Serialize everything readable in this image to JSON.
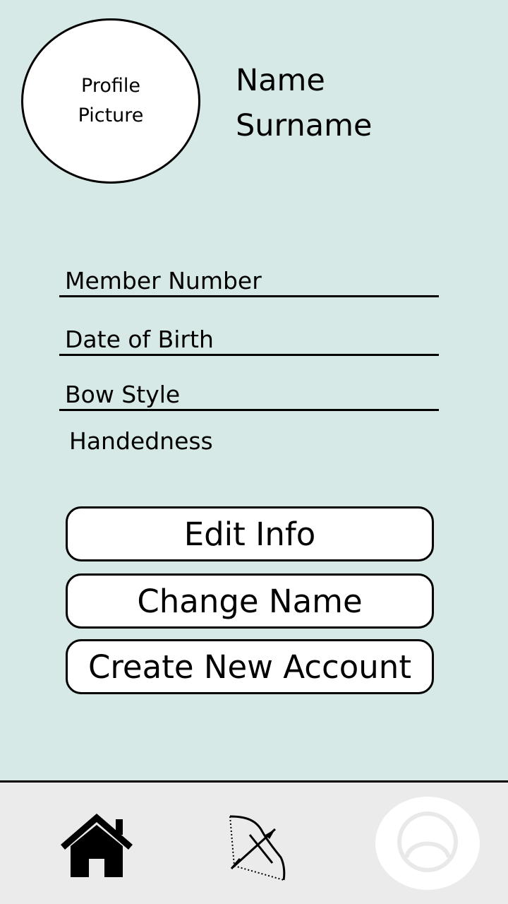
{
  "profile": {
    "picture_label": "Profile Picture",
    "first_name": "Name",
    "surname": "Surname"
  },
  "fields": {
    "member_number": "Member Number",
    "date_of_birth": "Date of Birth",
    "bow_style": "Bow Style",
    "handedness": "Handedness"
  },
  "buttons": {
    "edit_info": "Edit Info",
    "change_name": "Change Name",
    "create_account": "Create New Account"
  },
  "nav": {
    "items": [
      {
        "icon": "home-icon"
      },
      {
        "icon": "bow-and-arrow-icon"
      },
      {
        "icon": "profile-icon",
        "active": true
      }
    ]
  },
  "colors": {
    "background": "#d6e9e7",
    "nav_background": "#ebebeb"
  }
}
